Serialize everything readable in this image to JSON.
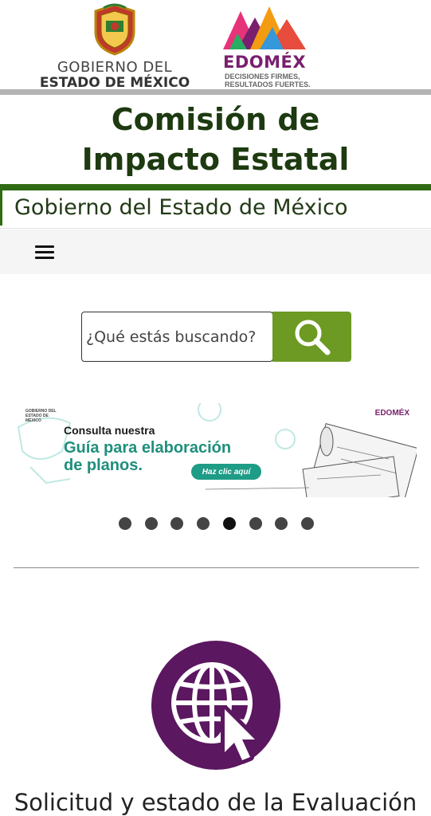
{
  "header": {
    "gobierno_logo": {
      "line1": "GOBIERNO DEL",
      "line2": "ESTADO DE MÉXICO"
    },
    "edomex_logo": {
      "word": "EDOMÉX",
      "tagline_line1": "DECISIONES FIRMES,",
      "tagline_line2": "RESULTADOS FUERTES."
    },
    "site_title": "Comisión de Impacto Estatal",
    "subtitle": "Gobierno del Estado de México"
  },
  "nav": {
    "menu_icon": "hamburger-menu-icon"
  },
  "search": {
    "placeholder": "¿Qué estás buscando?",
    "value": "",
    "button_icon": "search-icon"
  },
  "carousel": {
    "slide": {
      "gob_text": "GOBIERNO DEL ESTADO DE MÉXICO",
      "edomex_text": "EDOMÉX",
      "line_small": "Consulta nuestra",
      "line_big1": "Guía para elaboración",
      "line_big2": "de planos.",
      "cta": "Haz clic aquí"
    },
    "total_slides": 8,
    "active_index": 4
  },
  "service": {
    "icon": "globe-cursor-icon",
    "label": "Solicitud y estado de la Evaluación"
  },
  "colors": {
    "title_green": "#1d3a10",
    "rule_green": "#2f6b12",
    "search_green": "#6c9a23",
    "service_purple": "#5b1760",
    "banner_teal": "#1e8f7c"
  }
}
